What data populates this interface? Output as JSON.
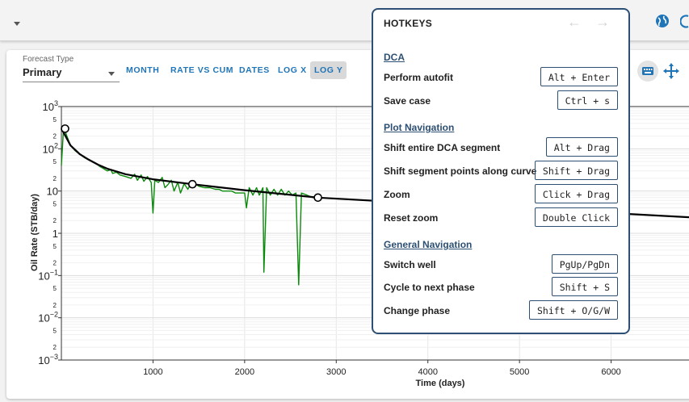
{
  "forecast_type": {
    "label": "Forecast Type",
    "value": "Primary"
  },
  "toolbar": {
    "buttons": [
      "MONTH",
      "RATE VS CUM",
      "DATES",
      "LOG X",
      "LOG Y"
    ],
    "active": "LOG Y"
  },
  "hotkeys": {
    "title": "HOTKEYS",
    "sections": [
      {
        "name": "DCA",
        "items": [
          {
            "label": "Perform autofit",
            "key": "Alt + Enter"
          },
          {
            "label": "Save case",
            "key": "Ctrl + s"
          }
        ]
      },
      {
        "name": "Plot Navigation",
        "items": [
          {
            "label": "Shift entire DCA segment",
            "key": "Alt + Drag"
          },
          {
            "label": "Shift segment points along curve",
            "key": "Shift + Drag"
          },
          {
            "label": "Zoom",
            "key": "Click + Drag"
          },
          {
            "label": "Reset zoom",
            "key": "Double Click"
          }
        ]
      },
      {
        "name": "General Navigation",
        "items": [
          {
            "label": "Switch well",
            "key": "PgUp/PgDn"
          },
          {
            "label": "Cycle to next phase",
            "key": "Shift + S"
          },
          {
            "label": "Change phase",
            "key": "Shift + O/G/W"
          }
        ]
      }
    ]
  },
  "chart_data": {
    "type": "line",
    "xlabel": "Time (days)",
    "ylabel": "Oil Rate (STB/day)",
    "y_scale": "log",
    "xlim": [
      0,
      6850
    ],
    "ylim": [
      0.001,
      1000
    ],
    "x_ticks": [
      1000,
      2000,
      3000,
      4000,
      5000,
      6000
    ],
    "y_ticks": [
      0.001,
      0.01,
      0.1,
      1,
      10,
      100,
      1000
    ],
    "grid": true,
    "colors": {
      "actual": "#0a8a0a",
      "forecast": "#000000"
    },
    "series": [
      {
        "role": "actual",
        "color": "#0a8a0a",
        "points": [
          [
            0,
            40
          ],
          [
            25,
            330
          ],
          [
            60,
            200
          ],
          [
            100,
            120
          ],
          [
            150,
            90
          ],
          [
            200,
            75
          ],
          [
            260,
            60
          ],
          [
            320,
            52
          ],
          [
            380,
            45
          ],
          [
            420,
            38
          ],
          [
            460,
            34
          ],
          [
            500,
            30
          ],
          [
            540,
            32
          ],
          [
            560,
            26
          ],
          [
            600,
            28
          ],
          [
            640,
            24
          ],
          [
            700,
            22
          ],
          [
            760,
            20
          ],
          [
            800,
            25
          ],
          [
            830,
            18
          ],
          [
            870,
            24
          ],
          [
            900,
            17
          ],
          [
            940,
            22
          ],
          [
            980,
            16
          ],
          [
            1000,
            3
          ],
          [
            1020,
            18
          ],
          [
            1060,
            16
          ],
          [
            1100,
            21
          ],
          [
            1130,
            12
          ],
          [
            1160,
            14
          ],
          [
            1200,
            18
          ],
          [
            1230,
            10
          ],
          [
            1270,
            16
          ],
          [
            1300,
            9
          ],
          [
            1340,
            15
          ],
          [
            1380,
            11
          ],
          [
            1420,
            16
          ],
          [
            1460,
            15
          ],
          [
            1500,
            13
          ],
          [
            1560,
            12
          ],
          [
            1620,
            12
          ],
          [
            1680,
            11
          ],
          [
            1720,
            11
          ],
          [
            1760,
            10
          ],
          [
            1810,
            10
          ],
          [
            1860,
            10
          ],
          [
            1900,
            9
          ],
          [
            1950,
            9
          ],
          [
            2000,
            9
          ],
          [
            2020,
            4
          ],
          [
            2050,
            12
          ],
          [
            2090,
            8
          ],
          [
            2130,
            12
          ],
          [
            2160,
            8
          ],
          [
            2200,
            12
          ],
          [
            2210,
            0.12
          ],
          [
            2240,
            12
          ],
          [
            2280,
            8
          ],
          [
            2320,
            11
          ],
          [
            2360,
            8
          ],
          [
            2400,
            11
          ],
          [
            2440,
            8
          ],
          [
            2480,
            10
          ],
          [
            2520,
            8
          ],
          [
            2560,
            9
          ],
          [
            2590,
            0.06
          ],
          [
            2620,
            9
          ],
          [
            2680,
            8
          ],
          [
            2740,
            7
          ],
          [
            2800,
            7
          ]
        ]
      },
      {
        "role": "forecast",
        "color": "#000000",
        "points": [
          [
            0,
            300
          ],
          [
            50,
            190
          ],
          [
            100,
            120
          ],
          [
            200,
            75
          ],
          [
            300,
            55
          ],
          [
            400,
            42
          ],
          [
            500,
            34
          ],
          [
            700,
            25
          ],
          [
            1000,
            19
          ],
          [
            1430,
            14.5
          ],
          [
            2000,
            10.5
          ],
          [
            2800,
            7
          ],
          [
            4000,
            5
          ],
          [
            5000,
            3.8
          ],
          [
            6000,
            3
          ],
          [
            6850,
            2.4
          ]
        ]
      }
    ],
    "control_points": [
      [
        40,
        300
      ],
      [
        1430,
        14.5
      ],
      [
        2800,
        7
      ]
    ]
  }
}
